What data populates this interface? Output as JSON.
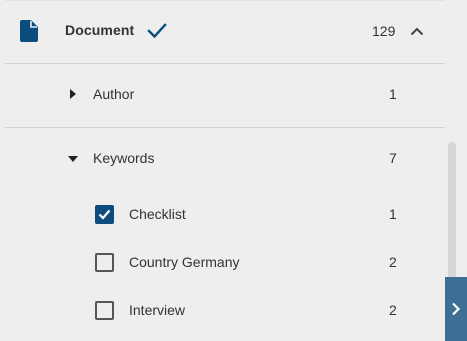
{
  "header": {
    "icon": "document-icon",
    "label": "Document",
    "selected_icon": "check-icon",
    "count": "129",
    "toggle_icon": "chevron-up-icon"
  },
  "facets": [
    {
      "label": "Author",
      "count": "1",
      "expanded": false
    },
    {
      "label": "Keywords",
      "count": "7",
      "expanded": true
    }
  ],
  "keywords": [
    {
      "label": "Checklist",
      "count": "1",
      "checked": true
    },
    {
      "label": "Country Germany",
      "count": "2",
      "checked": false
    },
    {
      "label": "Interview",
      "count": "2",
      "checked": false
    }
  ],
  "side_panel_toggle_icon": "chevron-right-icon",
  "colors": {
    "accent": "#0d4d7d",
    "background": "#eeeeee",
    "side_toggle": "#3d6f95"
  }
}
